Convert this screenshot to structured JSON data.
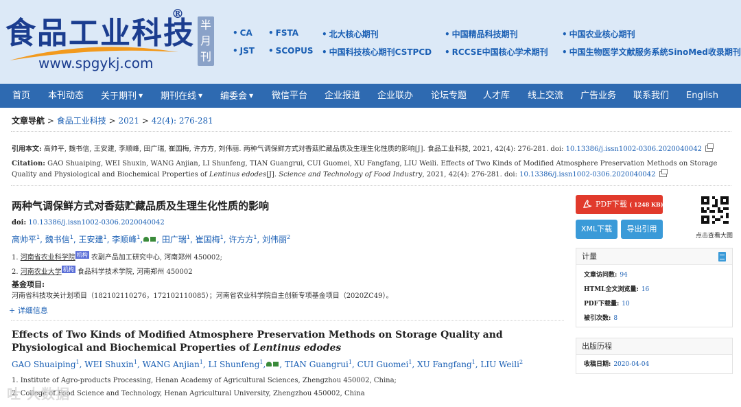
{
  "header": {
    "logo_title": "食品工业科技",
    "logo_registered": "®",
    "logo_url": "www.spgykj.com",
    "periodicity": [
      "半",
      "月",
      "刊"
    ],
    "indexes": [
      "CA",
      "FSTA",
      "北大核心期刊",
      "中国精品科技期刊",
      "中国农业核心期刊",
      "JST",
      "SCOPUS",
      "中国科技核心期刊CSTPCD",
      "RCCSE中国核心学术期刊",
      "中国生物医学文献服务系统SinoMed收录期刊"
    ]
  },
  "nav": {
    "items": [
      {
        "label": "首页",
        "dropdown": false
      },
      {
        "label": "本刊动态",
        "dropdown": false
      },
      {
        "label": "关于期刊",
        "dropdown": true
      },
      {
        "label": "期刊在线",
        "dropdown": true
      },
      {
        "label": "编委会",
        "dropdown": true
      },
      {
        "label": "微信平台",
        "dropdown": false
      },
      {
        "label": "企业报道",
        "dropdown": false
      },
      {
        "label": "企业联办",
        "dropdown": false
      },
      {
        "label": "论坛专题",
        "dropdown": false
      },
      {
        "label": "人才库",
        "dropdown": false
      },
      {
        "label": "线上交流",
        "dropdown": false
      },
      {
        "label": "广告业务",
        "dropdown": false
      },
      {
        "label": "联系我们",
        "dropdown": false
      },
      {
        "label": "English",
        "dropdown": false
      }
    ]
  },
  "breadcrumb": {
    "label": "文章导航",
    "sep": ">",
    "journal": "食品工业科技",
    "year": "2021",
    "issue": "42(4): 276-281"
  },
  "citation": {
    "cn_label": "引用本文:",
    "cn_text": "高帅平, 魏书信, 王安建, 李顺峰, 田广瑞, 崔国梅, 许方方, 刘伟丽. 两种气调保鲜方式对香菇贮藏品质及生理生化性质的影响[J]. 食品工业科技, 2021, 42(4): 276-281. doi:",
    "cn_doi": "10.13386/j.issn1002-0306.2020040042",
    "en_label": "Citation:",
    "en_text_1": "GAO Shuaiping, WEI Shuxin, WANG Anjian, LI Shunfeng, TIAN Guangrui, CUI Guomei, XU Fangfang, LIU Weili. Effects of Two Kinds of Modified Atmosphere Preservation Methods on Storage Quality and Physiological and Biochemical Properties of",
    "en_species": "Lentinus edodes",
    "en_text_2": "[J].",
    "en_journal": "Science and Technology of Food Industry",
    "en_text_3": ", 2021, 42(4): 276-281. doi:",
    "en_doi": "10.13386/j.issn1002-0306.2020040042"
  },
  "article": {
    "title_cn": "两种气调保鲜方式对香菇贮藏品质及生理生化性质的影响",
    "doi_label": "doi:",
    "doi": "10.13386/j.issn1002-0306.2020040042",
    "authors_cn": [
      {
        "name": "高帅平",
        "sup": "1",
        "corresponding": false
      },
      {
        "name": "魏书信",
        "sup": "1",
        "corresponding": false
      },
      {
        "name": "王安建",
        "sup": "1",
        "corresponding": false
      },
      {
        "name": "李顺峰",
        "sup": "1",
        "corresponding": true
      },
      {
        "name": "田广瑞",
        "sup": "1",
        "corresponding": false
      },
      {
        "name": "崔国梅",
        "sup": "1",
        "corresponding": false
      },
      {
        "name": "许方方",
        "sup": "1",
        "corresponding": false
      },
      {
        "name": "刘伟丽",
        "sup": "2",
        "corresponding": false
      }
    ],
    "affil_cn_1": {
      "num": "1.",
      "org": "河南省农业科学院",
      "badge": "机构",
      "rest": "农副产品加工研究中心, 河南郑州 450002;"
    },
    "affil_cn_2": {
      "num": "2.",
      "org": "河南农业大学",
      "badge": "机构",
      "rest": "食品科学技术学院, 河南郑州 450002"
    },
    "fund_label": "基金项目:",
    "fund_text": "河南省科技攻关计划项目（182102110276，172102110085）；河南省农业科学院自主创新专项基金项目（2020ZC49）。",
    "details_link": "+ 详细信息",
    "title_en_1": "Effects of Two Kinds of Modified Atmosphere Preservation Methods on Storage Quality and Physiological and Biochemical Properties of",
    "title_en_species": "Lentinus edodes",
    "authors_en": [
      {
        "name": "GAO Shuaiping",
        "sup": "1",
        "corresponding": false
      },
      {
        "name": "WEI Shuxin",
        "sup": "1",
        "corresponding": false
      },
      {
        "name": "WANG Anjian",
        "sup": "1",
        "corresponding": false
      },
      {
        "name": "LI Shunfeng",
        "sup": "1",
        "corresponding": true
      },
      {
        "name": "TIAN Guangrui",
        "sup": "1",
        "corresponding": false
      },
      {
        "name": "CUI Guomei",
        "sup": "1",
        "corresponding": false
      },
      {
        "name": "XU Fangfang",
        "sup": "1",
        "corresponding": false
      },
      {
        "name": "LIU Weili",
        "sup": "2",
        "corresponding": false
      }
    ],
    "affil_en_1": "1. Institute of Agro-products Processing, Henan Academy of Agricultural Sciences, Zhengzhou 450002, China;",
    "affil_en_2": "2. College of Food Science and Technology, Henan Agricultural University, Zhengzhou 450002, China"
  },
  "sidebar": {
    "pdf_label": "PDF下载",
    "pdf_size": "( 1248 KB)",
    "xml_label": "XML下载",
    "export_label": "导出引用",
    "qr_caption": "点击查看大图",
    "metrics_title": "计量",
    "metrics": [
      {
        "label": "文章访问数:",
        "value": "94"
      },
      {
        "label": "HTML全文浏览量:",
        "value": "16"
      },
      {
        "label": "PDF下载量:",
        "value": "10"
      },
      {
        "label": "被引次数:",
        "value": "8"
      }
    ],
    "history_title": "出版历程",
    "history": [
      {
        "label": "收稿日期:",
        "value": "2020-04-04"
      }
    ]
  },
  "watermark": "吐 大数据"
}
